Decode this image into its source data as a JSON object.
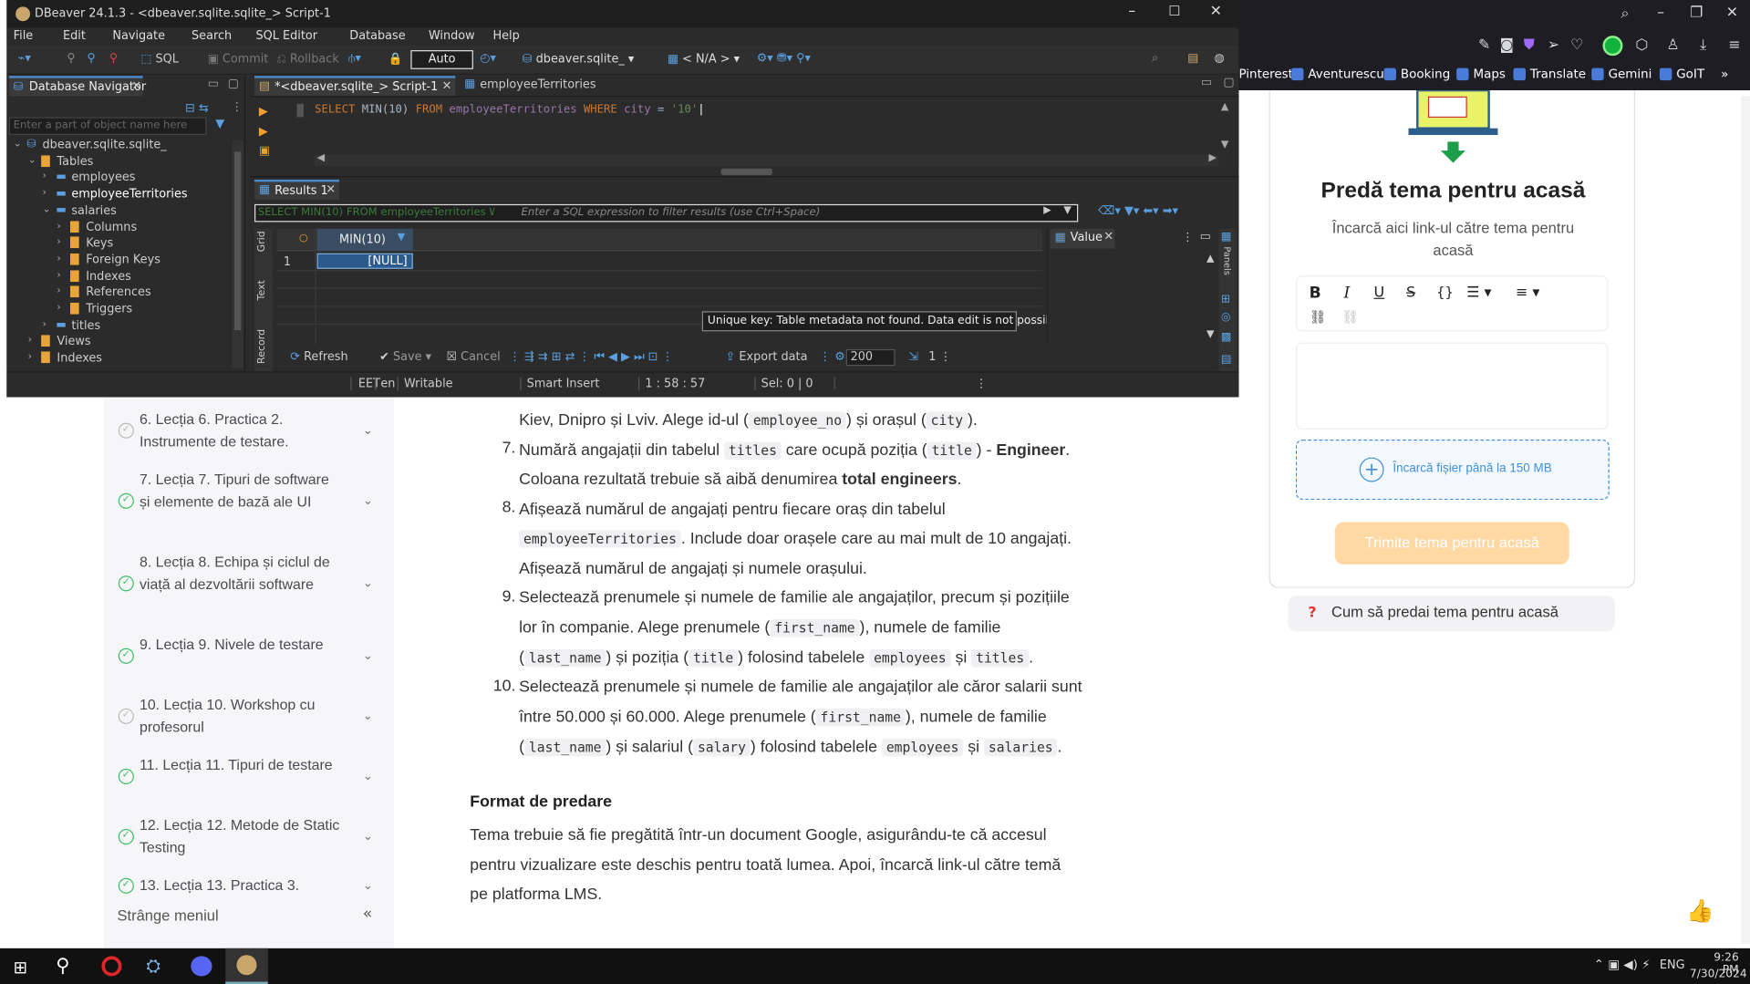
{
  "dbeaver": {
    "window_title": "DBeaver 24.1.3 - <dbeaver.sqlite.sqlite_> Script-1",
    "menu": [
      "File",
      "Edit",
      "Navigate",
      "Search",
      "SQL Editor",
      "Database",
      "Window",
      "Help"
    ],
    "toolbar": {
      "sql": "SQL",
      "commit": "Commit",
      "rollback": "Rollback",
      "auto": "Auto",
      "datasource": "dbeaver.sqlite_",
      "schema": "< N/A >"
    },
    "navigator": {
      "title": "Database Navigator",
      "filter_placeholder": "Enter a part of object name here",
      "tree": [
        {
          "label": "dbeaver.sqlite.sqlite_",
          "level": 0,
          "arrow": "v"
        },
        {
          "label": "Tables",
          "level": 1,
          "arrow": "v"
        },
        {
          "label": "employees",
          "level": 2,
          "arrow": ">"
        },
        {
          "label": "employeeTerritories",
          "level": 2,
          "arrow": ">"
        },
        {
          "label": "salaries",
          "level": 2,
          "arrow": "v"
        },
        {
          "label": "Columns",
          "level": 3,
          "arrow": ">"
        },
        {
          "label": "Keys",
          "level": 3,
          "arrow": ">"
        },
        {
          "label": "Foreign Keys",
          "level": 3,
          "arrow": ">"
        },
        {
          "label": "Indexes",
          "level": 3,
          "arrow": ">"
        },
        {
          "label": "References",
          "level": 3,
          "arrow": ">"
        },
        {
          "label": "Triggers",
          "level": 3,
          "arrow": ">"
        },
        {
          "label": "titles",
          "level": 2,
          "arrow": ">"
        },
        {
          "label": "Views",
          "level": 1,
          "arrow": ">"
        },
        {
          "label": "Indexes",
          "level": 1,
          "arrow": ">"
        }
      ]
    },
    "tabs": [
      "*<dbeaver.sqlite_> Script-1",
      "employeeTerritories"
    ],
    "sql": {
      "kw1": "SELECT",
      "fn": "MIN(10)",
      "kw2": "FROM",
      "table": "employeeTerritories",
      "kw3": "WHERE",
      "col": "city",
      "op": "=",
      "val": "'10'"
    },
    "results": {
      "tab": "Results 1",
      "filter_left": "SELECT MIN(10) FROM employeeTerritories W",
      "filter_placeholder": "Enter a SQL expression to filter results (use Ctrl+Space)",
      "column": "MIN(10)",
      "row_num": "1",
      "cell": "[NULL]",
      "value_tab": "Value",
      "tooltip": "Unique key: Table metadata not found. Data edit is not possible.",
      "side_tabs": [
        "Grid",
        "Text",
        "Record"
      ],
      "panels_label": "Panels",
      "bottom": {
        "refresh": "Refresh",
        "save": "Save",
        "cancel": "Cancel",
        "export": "Export data",
        "limit": "200",
        "count": "1"
      }
    },
    "status": {
      "tz": "EET",
      "lang": "en",
      "mode": "Writable",
      "insert": "Smart Insert",
      "pos": "1 : 58 : 57",
      "sel": "Sel: 0 | 0"
    }
  },
  "browser": {
    "bookmarks": [
      "Pinterest",
      "Aventurescu",
      "Booking",
      "Maps",
      "Translate",
      "Gemini",
      "GoIT"
    ]
  },
  "sidebar": {
    "lessons": [
      {
        "text": "6. Lecția 6. Practica 2. Instrumente de testare.",
        "done": false
      },
      {
        "text": "7. Lecția 7. Tipuri de software și elemente de bază ale UI",
        "done": true
      },
      {
        "text": "8. Lecția 8. Echipa și ciclul de viață al dezvoltării software",
        "done": true
      },
      {
        "text": "9. Lecția 9. Nivele de testare",
        "done": true
      },
      {
        "text": "10. Lecția 10. Workshop cu profesorul",
        "done": false
      },
      {
        "text": "11. Lecția 11. Tipuri de testare",
        "done": true
      },
      {
        "text": "12. Lecția 12. Metode de Static Testing",
        "done": true
      },
      {
        "text": "13. Lecția 13. Practica 3.",
        "done": true
      }
    ],
    "collapse": "Strânge meniul"
  },
  "content": {
    "item6_tail": "Kiev, Dnipro și Lviv. Alege id-ul (",
    "c_employee_no": "employee_no",
    "item6_mid": ") și orașul (",
    "c_city": "city",
    "item6_end": ").",
    "i7": {
      "num": "7.",
      "a": "Numără angajații din tabelul ",
      "c1": "titles",
      "b": " care ocupă poziția (",
      "c2": "title",
      "c": ") - ",
      "bold": "Engineer",
      "d": ".",
      "line2a": "Coloana rezultată trebuie să aibă denumirea ",
      "bold2": "total engineers",
      "line2b": "."
    },
    "i8": {
      "num": "8.",
      "line1": "Afișează numărul de angajați pentru fiecare oraș din tabelul",
      "c1": "employeeTerritories",
      "line2": ". Include doar orașele care au mai mult de 10 angajați.",
      "line3": "Afișează numărul de angajați și numele orașului."
    },
    "i9": {
      "num": "9.",
      "line1": "Selectează prenumele și numele de familie ale angajaților, precum și pozițiile",
      "line2a": "lor în companie. Alege prenumele (",
      "c1": "first_name",
      "line2b": "), numele de familie",
      "line3a": "(",
      "c2": "last_name",
      "line3b": ") și poziția (",
      "c3": "title",
      "line3c": ") folosind tabelele ",
      "c4": "employees",
      "line3d": " și ",
      "c5": "titles",
      "line3e": "."
    },
    "i10": {
      "num": "10.",
      "line1": "Selectează prenumele și numele de familie ale angajaților ale căror salarii sunt",
      "line2a": "între 50.000 și 60.000. Alege prenumele (",
      "c1": "first_name",
      "line2b": "), numele de familie",
      "line3a": "(",
      "c2": "last_name",
      "line3b": ") și salariul (",
      "c3": "salary",
      "line3c": ") folosind tabelele ",
      "c4": "employees",
      "line3d": " și ",
      "c5": "salaries",
      "line3e": "."
    },
    "format_title": "Format de predare",
    "format_text": [
      "Tema trebuie să fie pregătită într-un document Google, asigurându-te că accesul",
      "pentru vizualizare este deschis pentru toată lumea. Apoi, încarcă link-ul către temă",
      "pe platforma LMS."
    ]
  },
  "submit": {
    "title": "Predă tema pentru acasă",
    "subtitle1": "Încarcă aici link-ul către tema pentru",
    "subtitle2": "acasă",
    "upload": "Încarcă fișier până la 150 MB",
    "send": "Trimite tema pentru acasă",
    "help": "Cum să predai tema pentru acasă"
  },
  "taskbar": {
    "lang": "ENG",
    "time": "9:26 PM",
    "date": "7/30/2024"
  }
}
